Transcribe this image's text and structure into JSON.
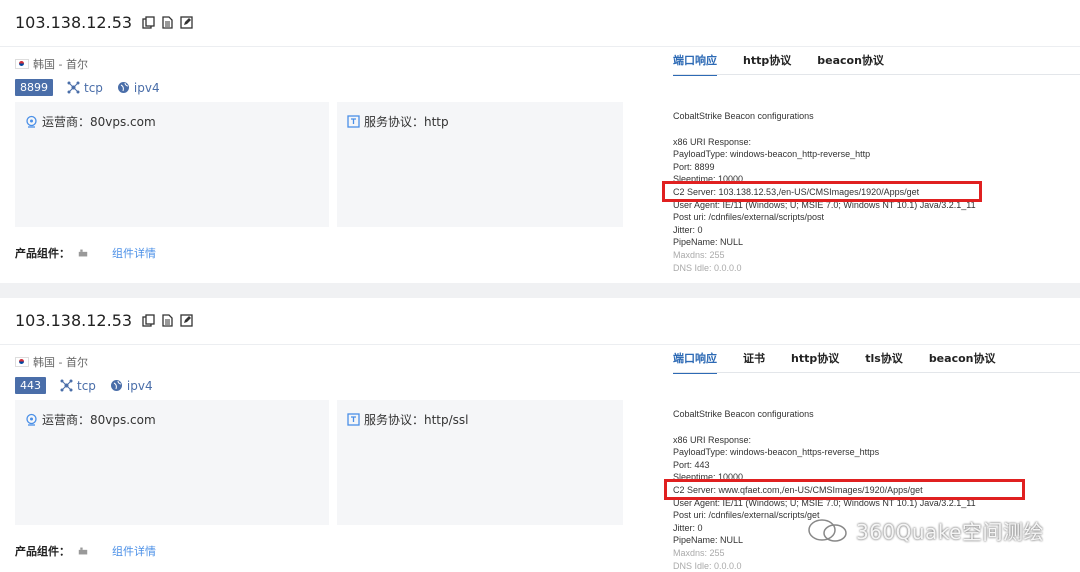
{
  "results": [
    {
      "ip": "103.138.12.53",
      "location": "韩国 - 首尔",
      "port": "8899",
      "transport": "tcp",
      "ip_version": "ipv4",
      "operator_label": "运营商：80vps.com",
      "service_label": "服务协议：http",
      "product_label": "产品组件：",
      "product_link": "组件详情",
      "tabs": [
        "端口响应",
        "http协议",
        "beacon协议"
      ],
      "active_tab": "端口响应",
      "response_title": "CobaltStrike Beacon configurations",
      "response_lines": [
        "x86 URI Response:",
        "PayloadType: windows-beacon_http-reverse_http",
        "Port: 8899",
        "Sleeptime: 10000",
        "C2 Server: 103.138.12.53,/en-US/CMSImages/1920/Apps/get",
        "User Agent: IE/11 (Windows; U; MSIE 7.0; Windows NT 10.1) Java/3.2.1_11",
        "Post uri: /cdnfiles/external/scripts/post",
        "Jitter: 0",
        "PipeName: NULL",
        "Maxdns: 255",
        "DNS Idle: 0.0.0.0"
      ]
    },
    {
      "ip": "103.138.12.53",
      "location": "韩国 - 首尔",
      "port": "443",
      "transport": "tcp",
      "ip_version": "ipv4",
      "operator_label": "运营商：80vps.com",
      "service_label": "服务协议：http/ssl",
      "product_label": "产品组件：",
      "product_link": "组件详情",
      "tabs": [
        "端口响应",
        "证书",
        "http协议",
        "tls协议",
        "beacon协议"
      ],
      "active_tab": "端口响应",
      "response_title": "CobaltStrike Beacon configurations",
      "response_lines": [
        "x86 URI Response:",
        "PayloadType: windows-beacon_https-reverse_https",
        "Port: 443",
        "Sleeptime: 10000",
        "C2 Server: www.qfaet.com,/en-US/CMSImages/1920/Apps/get",
        "User Agent: IE/11 (Windows; U; MSIE 7.0; Windows NT 10.1) Java/3.2.1_11",
        "Post uri: /cdnfiles/external/scripts/get",
        "Jitter: 0",
        "PipeName: NULL",
        "Maxdns: 255",
        "DNS Idle: 0.0.0.0"
      ]
    }
  ],
  "watermark": "360Quake空间测绘",
  "colors": {
    "accent": "#2d6ab5",
    "port_badge": "#4a6ea9",
    "highlight": "#e02020",
    "link": "#4a8fe7"
  }
}
